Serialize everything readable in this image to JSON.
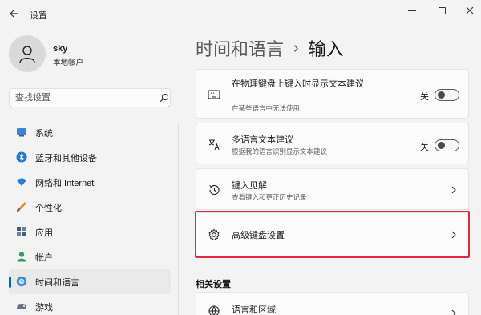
{
  "window": {
    "title": "设置",
    "back_icon": "back-arrow-icon",
    "controls": [
      "minimize-icon",
      "maximize-icon",
      "close-icon"
    ]
  },
  "profile": {
    "name": "sky",
    "account_type": "本地帐户"
  },
  "search": {
    "placeholder": "查找设置"
  },
  "nav": {
    "items": [
      {
        "label": "系统",
        "icon": "monitor-icon"
      },
      {
        "label": "蓝牙和其他设备",
        "icon": "bluetooth-icon"
      },
      {
        "label": "网络和 Internet",
        "icon": "wifi-icon"
      },
      {
        "label": "个性化",
        "icon": "brush-icon"
      },
      {
        "label": "应用",
        "icon": "apps-icon"
      },
      {
        "label": "帐户",
        "icon": "person-icon"
      },
      {
        "label": "时间和语言",
        "icon": "globe-clock-icon",
        "active": true
      },
      {
        "label": "游戏",
        "icon": "gamepad-icon"
      }
    ]
  },
  "header": {
    "parent": "时间和语言",
    "separator": "›",
    "current": "输入"
  },
  "cards": [
    {
      "title": "在物理键盘上键入时显示文本建议",
      "description": "在某些语言中无法使用",
      "toggle_state": "关",
      "icon": "keyboard-icon"
    },
    {
      "title": "多语言文本建议",
      "description": "根据我的语言识别显示文本建议",
      "toggle_state": "关",
      "icon": "language-icon"
    },
    {
      "title": "键入见解",
      "description": "查看键入和更正历史记录",
      "icon": "history-icon"
    },
    {
      "title": "高级键盘设置",
      "icon": "gear-icon"
    }
  ],
  "related": {
    "section_title": "相关设置",
    "items": [
      {
        "title": "语言和区域",
        "icon": "globe-icon"
      }
    ]
  },
  "colors": {
    "accent": "#0067c0",
    "highlight_border": "#e0283c",
    "background": "#f3f3f3",
    "card_background": "#fbfbfb"
  }
}
